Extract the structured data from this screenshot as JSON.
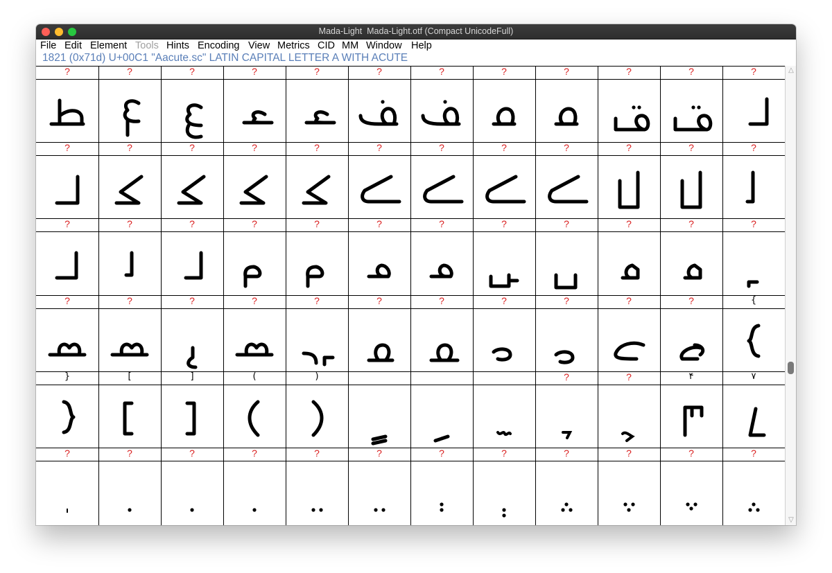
{
  "window": {
    "title": "Mada-Light  Mada-Light.otf (Compact UnicodeFull)"
  },
  "menu": [
    {
      "label": "File",
      "enabled": true
    },
    {
      "label": "Edit",
      "enabled": true
    },
    {
      "label": "Element",
      "enabled": true
    },
    {
      "label": "Tools",
      "enabled": false
    },
    {
      "label": "Hints",
      "enabled": true
    },
    {
      "label": "Encoding",
      "enabled": true
    },
    {
      "label": "View",
      "enabled": true
    },
    {
      "label": "Metrics",
      "enabled": true
    },
    {
      "label": "CID",
      "enabled": true
    },
    {
      "label": "MM",
      "enabled": true
    },
    {
      "label": "Window",
      "enabled": true
    },
    {
      "label": "Help",
      "enabled": true
    }
  ],
  "status": {
    "text": "1821 (0x71d) U+00C1 \"Aacute.sc\" LATIN CAPITAL LETTER A WITH ACUTE"
  },
  "colors": {
    "status_text": "#5a7fb8",
    "missing_label": "#d92020",
    "titlebar": "#363636"
  },
  "glyph_grid": {
    "rows": [
      {
        "labels": [
          "?",
          "?",
          "?",
          "?",
          "?",
          "?",
          "?",
          "?",
          "?",
          "?",
          "?",
          "?"
        ]
      },
      {
        "labels": [
          "?",
          "?",
          "?",
          "?",
          "?",
          "?",
          "?",
          "?",
          "?",
          "?",
          "?",
          "?"
        ]
      },
      {
        "labels": [
          "?",
          "?",
          "?",
          "?",
          "?",
          "?",
          "?",
          "?",
          "?",
          "?",
          "?",
          "?"
        ]
      },
      {
        "labels": [
          "?",
          "?",
          "?",
          "?",
          "?",
          "?",
          "?",
          "?",
          "?",
          "?",
          "?",
          "{"
        ]
      },
      {
        "labels": [
          "}",
          "[",
          "]",
          "(",
          ")",
          "",
          "",
          "",
          "?",
          "?",
          "۴",
          "۷"
        ]
      },
      {
        "labels": [
          "?",
          "?",
          "?",
          "?",
          "?",
          "?",
          "?",
          "?",
          "?",
          "?",
          "?",
          "?"
        ]
      }
    ]
  },
  "scrollbar": {
    "position_fraction": 0.67
  }
}
